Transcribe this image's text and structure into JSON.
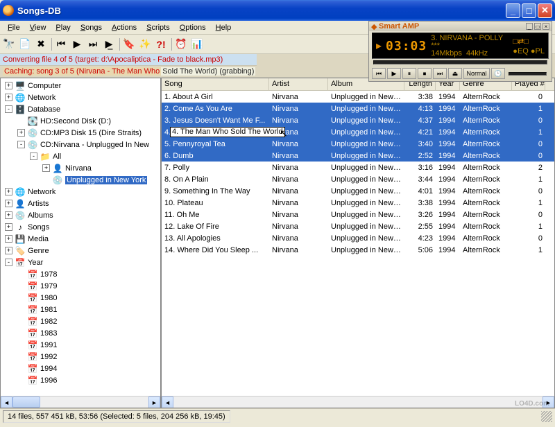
{
  "window": {
    "title": "Songs-DB"
  },
  "menu": [
    "File",
    "View",
    "Play",
    "Songs",
    "Actions",
    "Scripts",
    "Options",
    "Help"
  ],
  "status": {
    "line1": "Converting file 4 of 5 (target: d:\\Apocaliptica - Fade to black.mp3)",
    "line2a": "Caching: song 3 of 5 (Nirvana - The Man Who ",
    "line2b": "Sold The World)  (grabbing)"
  },
  "player": {
    "name": "Smart AMP",
    "time": "03:03",
    "track": "3. NIRVANA - POLLY  ***",
    "bitrate": "14Mkbps",
    "freq": "44kHz",
    "mode": "Normal"
  },
  "tree": [
    {
      "d": 0,
      "exp": "+",
      "icon": "🖥️",
      "label": "Computer"
    },
    {
      "d": 0,
      "exp": "+",
      "icon": "🌐",
      "label": "Network"
    },
    {
      "d": 0,
      "exp": "-",
      "icon": "🗄️",
      "label": "Database"
    },
    {
      "d": 1,
      "exp": " ",
      "icon": "💽",
      "label": "HD:Second Disk (D:)"
    },
    {
      "d": 1,
      "exp": "+",
      "icon": "💿",
      "label": "CD:MP3 Disk 15  (Dire Straits)"
    },
    {
      "d": 1,
      "exp": "-",
      "icon": "💿",
      "label": "CD:Nirvana - Unplugged In New"
    },
    {
      "d": 2,
      "exp": "-",
      "icon": "📁",
      "label": "All"
    },
    {
      "d": 3,
      "exp": "+",
      "icon": "👤",
      "label": "Nirvana"
    },
    {
      "d": 3,
      "exp": " ",
      "icon": "💿",
      "label": "Unplugged in New York",
      "sel": true
    },
    {
      "d": 0,
      "exp": "+",
      "icon": "🌐",
      "label": "Network"
    },
    {
      "d": 0,
      "exp": "+",
      "icon": "👤",
      "label": "Artists"
    },
    {
      "d": 0,
      "exp": "+",
      "icon": "💿",
      "label": "Albums"
    },
    {
      "d": 0,
      "exp": "+",
      "icon": "♪",
      "label": "Songs"
    },
    {
      "d": 0,
      "exp": "+",
      "icon": "💾",
      "label": "Media"
    },
    {
      "d": 0,
      "exp": "+",
      "icon": "🏷️",
      "label": "Genre"
    },
    {
      "d": 0,
      "exp": "-",
      "icon": "📅",
      "label": "Year"
    },
    {
      "d": 1,
      "exp": " ",
      "icon": "📅",
      "label": "1978"
    },
    {
      "d": 1,
      "exp": " ",
      "icon": "📅",
      "label": "1979"
    },
    {
      "d": 1,
      "exp": " ",
      "icon": "📅",
      "label": "1980"
    },
    {
      "d": 1,
      "exp": " ",
      "icon": "📅",
      "label": "1981"
    },
    {
      "d": 1,
      "exp": " ",
      "icon": "📅",
      "label": "1982"
    },
    {
      "d": 1,
      "exp": " ",
      "icon": "📅",
      "label": "1983"
    },
    {
      "d": 1,
      "exp": " ",
      "icon": "📅",
      "label": "1991"
    },
    {
      "d": 1,
      "exp": " ",
      "icon": "📅",
      "label": "1992"
    },
    {
      "d": 1,
      "exp": " ",
      "icon": "📅",
      "label": "1994"
    },
    {
      "d": 1,
      "exp": " ",
      "icon": "📅",
      "label": "1996"
    }
  ],
  "columns": [
    "Song",
    "Artist",
    "Album",
    "Length",
    "Year",
    "Genre",
    "Played #"
  ],
  "rows": [
    {
      "n": 1,
      "song": "About A Girl",
      "artist": "Nirvana",
      "album": "Unplugged in New ...",
      "length": "3:38",
      "year": "1994",
      "genre": "AlternRock",
      "played": "0"
    },
    {
      "n": 2,
      "song": "Come As You Are",
      "artist": "Nirvana",
      "album": "Unplugged in New ...",
      "length": "4:13",
      "year": "1994",
      "genre": "AlternRock",
      "played": "1",
      "sel": true
    },
    {
      "n": 3,
      "song": "Jesus Doesn't Want Me F...",
      "artist": "Nirvana",
      "album": "Unplugged in New ...",
      "length": "4:37",
      "year": "1994",
      "genre": "AlternRock",
      "played": "0",
      "sel": true
    },
    {
      "n": 4,
      "song": "The Man Who Sold The World",
      "artist": "Nirvana",
      "album": "Unplugged in New ...",
      "length": "4:21",
      "year": "1994",
      "genre": "AlternRock",
      "played": "1",
      "sel": true,
      "editing": true
    },
    {
      "n": 5,
      "song": "Pennyroyal Tea",
      "artist": "Nirvana",
      "album": "Unplugged in New ...",
      "length": "3:40",
      "year": "1994",
      "genre": "AlternRock",
      "played": "0",
      "sel": true
    },
    {
      "n": 6,
      "song": "Dumb",
      "artist": "Nirvana",
      "album": "Unplugged in New ...",
      "length": "2:52",
      "year": "1994",
      "genre": "AlternRock",
      "played": "0",
      "sel": true
    },
    {
      "n": 7,
      "song": "Polly",
      "artist": "Nirvana",
      "album": "Unplugged in New ...",
      "length": "3:16",
      "year": "1994",
      "genre": "AlternRock",
      "played": "2"
    },
    {
      "n": 8,
      "song": "On A Plain",
      "artist": "Nirvana",
      "album": "Unplugged in New ...",
      "length": "3:44",
      "year": "1994",
      "genre": "AlternRock",
      "played": "1"
    },
    {
      "n": 9,
      "song": "Something In The Way",
      "artist": "Nirvana",
      "album": "Unplugged in New ...",
      "length": "4:01",
      "year": "1994",
      "genre": "AlternRock",
      "played": "0"
    },
    {
      "n": 10,
      "song": "Plateau",
      "artist": "Nirvana",
      "album": "Unplugged in New ...",
      "length": "3:38",
      "year": "1994",
      "genre": "AlternRock",
      "played": "1"
    },
    {
      "n": 11,
      "song": "Oh Me",
      "artist": "Nirvana",
      "album": "Unplugged in New ...",
      "length": "3:26",
      "year": "1994",
      "genre": "AlternRock",
      "played": "0"
    },
    {
      "n": 12,
      "song": "Lake Of Fire",
      "artist": "Nirvana",
      "album": "Unplugged in New ...",
      "length": "2:55",
      "year": "1994",
      "genre": "AlternRock",
      "played": "1"
    },
    {
      "n": 13,
      "song": "All Apologies",
      "artist": "Nirvana",
      "album": "Unplugged in New ...",
      "length": "4:23",
      "year": "1994",
      "genre": "AlternRock",
      "played": "0"
    },
    {
      "n": 14,
      "song": "Where Did You Sleep ...",
      "artist": "Nirvana",
      "album": "Unplugged in New ...",
      "length": "5:06",
      "year": "1994",
      "genre": "AlternRock",
      "played": "1"
    }
  ],
  "statusbar": "14 files, 557 451 kB, 53:56 (Selected: 5 files, 204 256 kB, 19:45)",
  "watermark": "LO4D.com"
}
